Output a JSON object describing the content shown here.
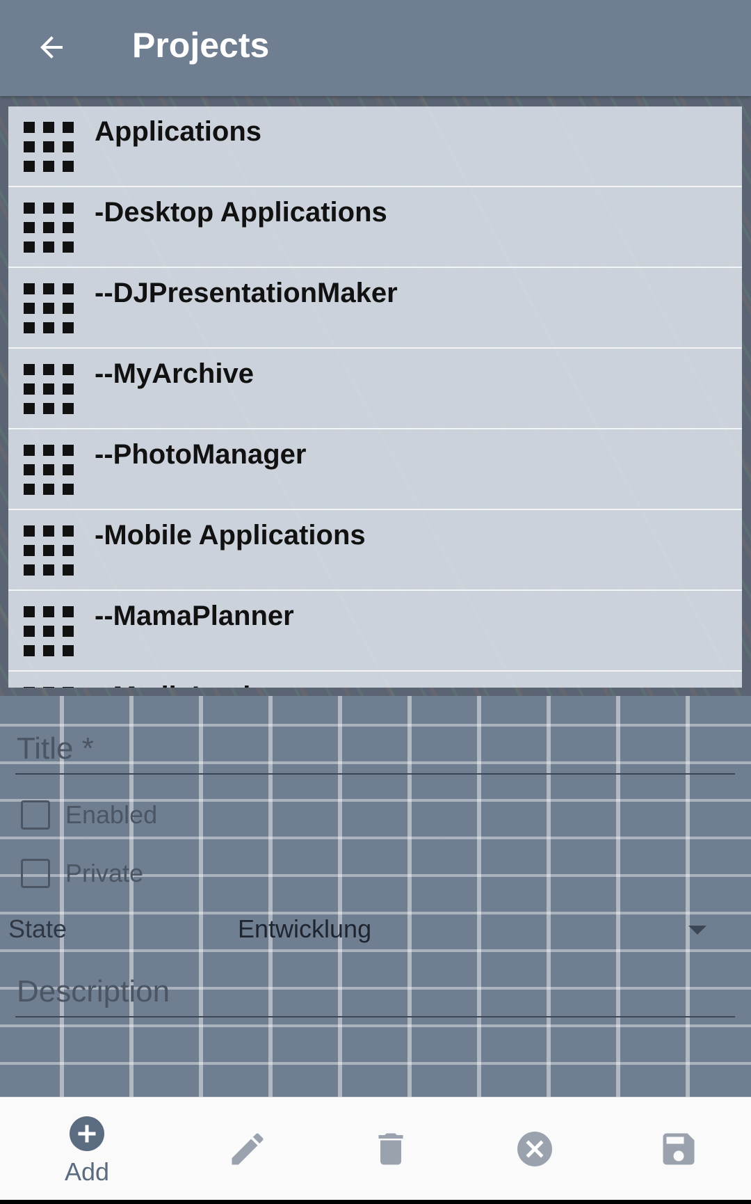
{
  "appbar": {
    "title": "Projects",
    "back_icon": "arrow-back-icon"
  },
  "projects": [
    {
      "label": "Applications",
      "icon": "grid-icon"
    },
    {
      "label": "-Desktop Applications",
      "icon": "grid-icon"
    },
    {
      "label": "--DJPresentationMaker",
      "icon": "grid-icon"
    },
    {
      "label": "--MyArchive",
      "icon": "grid-icon"
    },
    {
      "label": "--PhotoManager",
      "icon": "grid-icon"
    },
    {
      "label": "-Mobile Applications",
      "icon": "grid-icon"
    },
    {
      "label": "--MamaPlanner",
      "icon": "grid-icon"
    },
    {
      "label": "--MediaLooker",
      "icon": "grid-icon"
    }
  ],
  "form": {
    "title_placeholder": "Title *",
    "enabled_label": "Enabled",
    "private_label": "Private",
    "state_label": "State",
    "state_value": "Entwicklung",
    "description_placeholder": "Description"
  },
  "toolbar": {
    "add_label": "Add",
    "icons": [
      "add-circle-icon",
      "edit-icon",
      "delete-icon",
      "cancel-icon",
      "save-icon"
    ]
  },
  "colors": {
    "appbar": "#6f7f91",
    "toolbar_icon": "#5b6b80",
    "toolbar_bg": "#fafafa"
  }
}
